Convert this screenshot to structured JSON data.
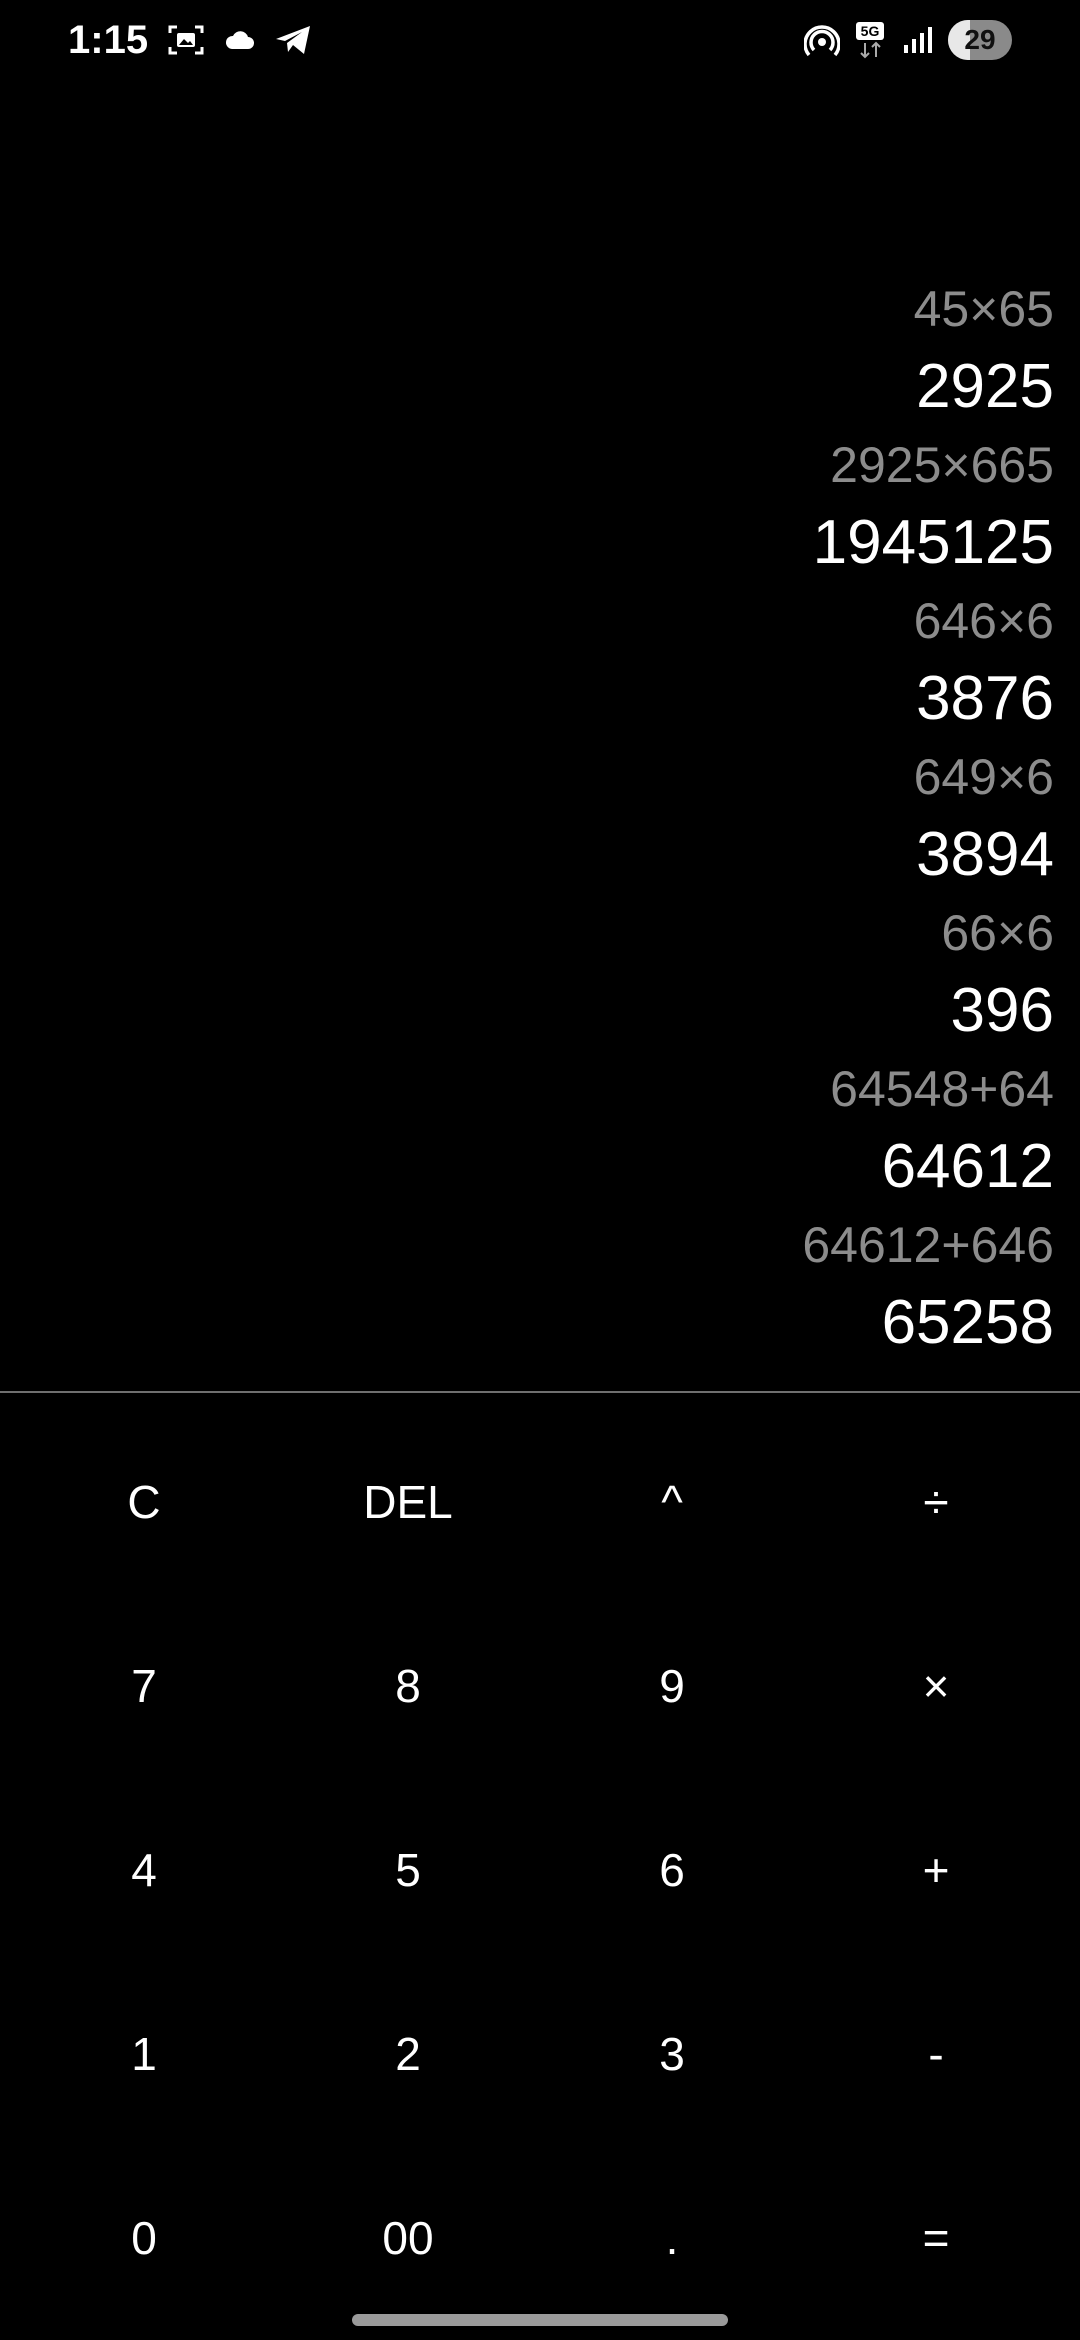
{
  "status_bar": {
    "time": "1:15",
    "network": "5G",
    "battery": "29",
    "left_icons": [
      "screenshot-icon",
      "cloud-icon",
      "telegram-icon"
    ],
    "right_icons": [
      "hotspot-icon",
      "5g-data-icon",
      "signal-icon",
      "battery-icon"
    ]
  },
  "history": [
    {
      "expression": "45×65",
      "result": "2925"
    },
    {
      "expression": "2925×665",
      "result": "1945125"
    },
    {
      "expression": "646×6",
      "result": "3876"
    },
    {
      "expression": "649×6",
      "result": "3894"
    },
    {
      "expression": "66×6",
      "result": "396"
    },
    {
      "expression": "64548+64",
      "result": "64612"
    },
    {
      "expression": "64612+646",
      "result": "65258"
    }
  ],
  "keypad": {
    "rows": [
      [
        "C",
        "DEL",
        "^",
        "÷"
      ],
      [
        "7",
        "8",
        "9",
        "×"
      ],
      [
        "4",
        "5",
        "6",
        "+"
      ],
      [
        "1",
        "2",
        "3",
        "-"
      ],
      [
        "0",
        "00",
        ".",
        "="
      ]
    ]
  },
  "colors": {
    "background": "#000000",
    "expression_text": "#8c8c8c",
    "result_text": "#ffffff",
    "divider": "#6f6f6f"
  }
}
